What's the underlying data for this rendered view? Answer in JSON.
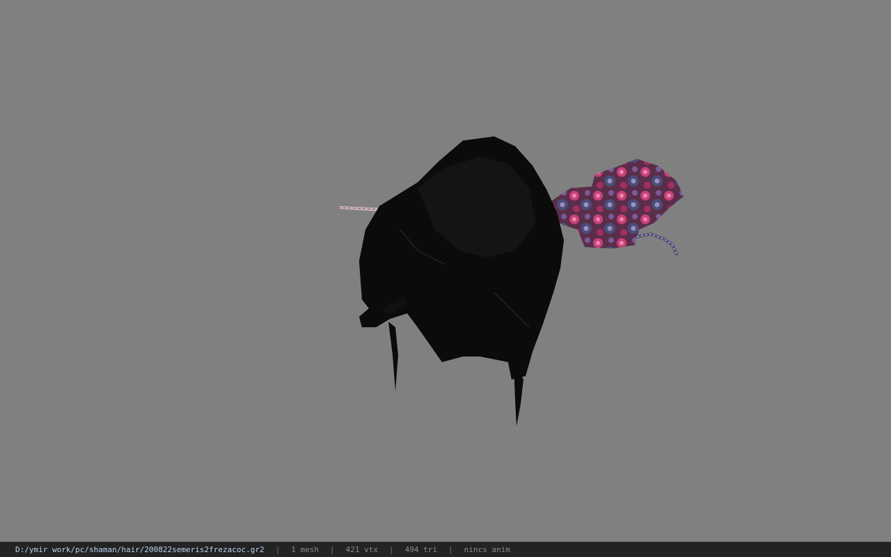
{
  "viewport": {
    "background_color": "#808080",
    "model": {
      "name": "hair-mesh",
      "colors": {
        "hair": "#0b0b0b",
        "hair_shade": "#161616",
        "ornament_base": "#5a2e4a",
        "ornament_pink": "#c8407a",
        "ornament_blue": "#4a4d78",
        "pin": "#c9b3bd"
      }
    }
  },
  "status_bar": {
    "file_path": "D:/ymir work/pc/shaman/hair/200822semeris2frezacoc.gr2",
    "separator": "|",
    "mesh_count": "1 mesh",
    "vertex_count": "421 vtx",
    "triangle_count": "494 tri",
    "animation": "nincs anim",
    "colors": {
      "background": "#232323",
      "path": "#b9d3f0",
      "text": "#8c8c8c"
    }
  }
}
